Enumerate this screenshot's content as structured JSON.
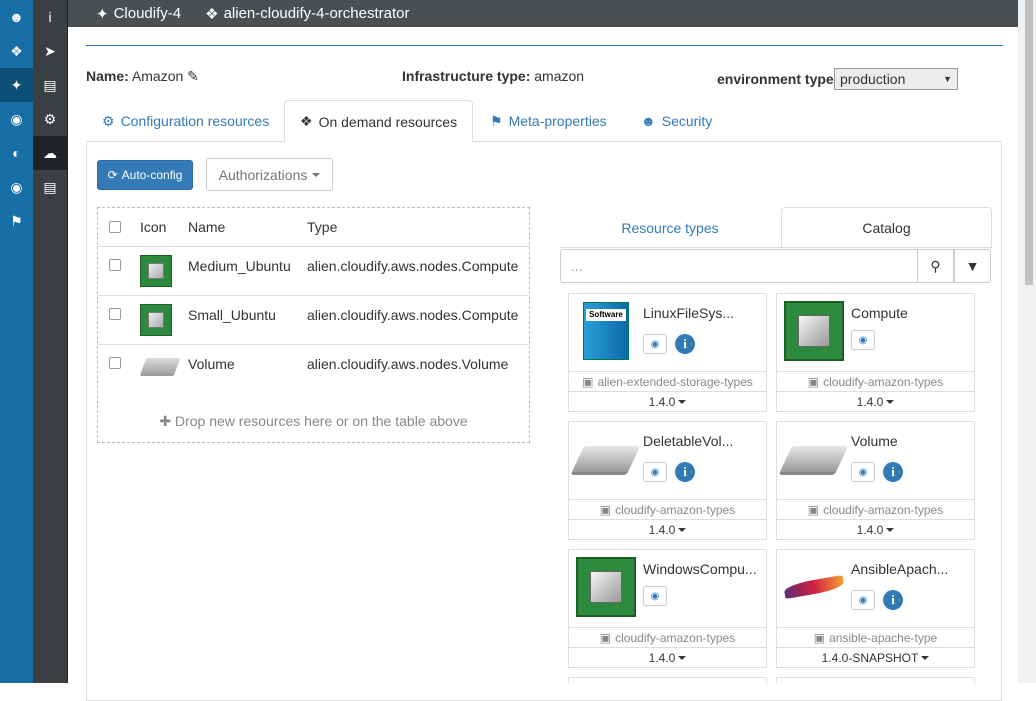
{
  "breadcrumb": {
    "item1": "Cloudify-4",
    "item2": "alien-cloudify-4-orchestrator"
  },
  "location": {
    "name_label": "Name:",
    "name_value": "Amazon",
    "infra_label": "Infrastructure type:",
    "infra_value": "amazon",
    "env_label": "environment type:",
    "env_value": "production"
  },
  "tabs": [
    {
      "label": "Configuration resources"
    },
    {
      "label": "On demand resources"
    },
    {
      "label": "Meta-properties"
    },
    {
      "label": "Security"
    }
  ],
  "toolbar": {
    "autoconfig": "Auto-config",
    "authorizations": "Authorizations"
  },
  "table": {
    "headers": [
      "Icon",
      "Name",
      "Type"
    ],
    "rows": [
      {
        "name": "Medium_Ubuntu",
        "type": "alien.cloudify.aws.nodes.Compute"
      },
      {
        "name": "Small_Ubuntu",
        "type": "alien.cloudify.aws.nodes.Compute"
      },
      {
        "name": "Volume",
        "type": "alien.cloudify.aws.nodes.Volume"
      }
    ],
    "drop_hint": "Drop new resources here or on the table above"
  },
  "right_tabs": {
    "resource_types": "Resource types",
    "catalog": "Catalog"
  },
  "search": {
    "placeholder": "..."
  },
  "cards": [
    {
      "name": "LinuxFileSys...",
      "archive": "alien-extended-storage-types",
      "version": "1.4.0"
    },
    {
      "name": "Compute",
      "archive": "cloudify-amazon-types",
      "version": "1.4.0"
    },
    {
      "name": "DeletableVol...",
      "archive": "cloudify-amazon-types",
      "version": "1.4.0"
    },
    {
      "name": "Volume",
      "archive": "cloudify-amazon-types",
      "version": "1.4.0"
    },
    {
      "name": "WindowsCompu...",
      "archive": "cloudify-amazon-types",
      "version": "1.4.0"
    },
    {
      "name": "AnsibleApach...",
      "archive": "ansible-apache-type",
      "version": "1.4.0-SNAPSHOT"
    }
  ],
  "icons": {
    "software_box_label": "Software"
  },
  "colors": {
    "primary": "#337ab7",
    "left_nav": "#176fa6",
    "side_nav": "#3a3f44"
  }
}
